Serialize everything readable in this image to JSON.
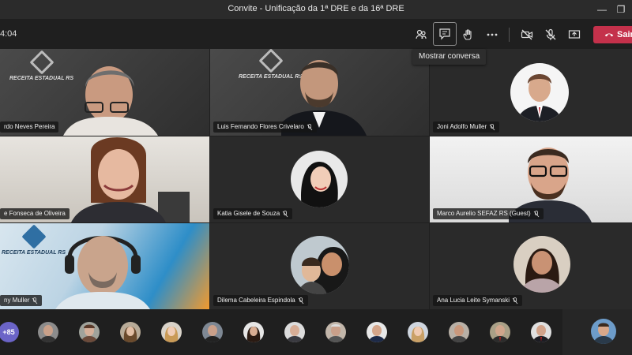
{
  "window": {
    "title": "Convite - Unificação da 1ª DRE e da 16ª DRE"
  },
  "toolbar": {
    "timer": "4:04",
    "leave_label": "Sair",
    "tooltip": "Mostrar conversa"
  },
  "icons": [
    "people-icon",
    "chat-icon",
    "raise-hand-icon",
    "more-options-icon",
    "camera-off-icon",
    "mic-off-icon",
    "share-screen-icon",
    "phone-hangup-icon"
  ],
  "participants": [
    {
      "name": "rdo Neves Pereira",
      "muted": false,
      "logo": "RECEITA ESTADUAL RS"
    },
    {
      "name": "Luis Fernando Flores Crivelaro",
      "muted": true,
      "logo": "RECEITA ESTADUAL RS"
    },
    {
      "name": "Joni Adolfo Muller",
      "muted": true
    },
    {
      "name": "e Fonseca de Oliveira",
      "muted": false
    },
    {
      "name": "Katia Gisele de Souza",
      "muted": true
    },
    {
      "name": "Marco Aurelio SEFAZ RS (Guest)",
      "muted": true
    },
    {
      "name": "ny Muller",
      "muted": true,
      "logo": "RECEITA ESTADUAL RS"
    },
    {
      "name": "Dilema Cabeleira Espindola",
      "muted": true
    },
    {
      "name": "Ana Lucia Leite Symanski",
      "muted": true
    }
  ],
  "overflow": {
    "count": "+85"
  },
  "colors": {
    "leave": "#c4314b",
    "overflow_badge": "#6b64c7",
    "background": "#1f1f1f"
  }
}
